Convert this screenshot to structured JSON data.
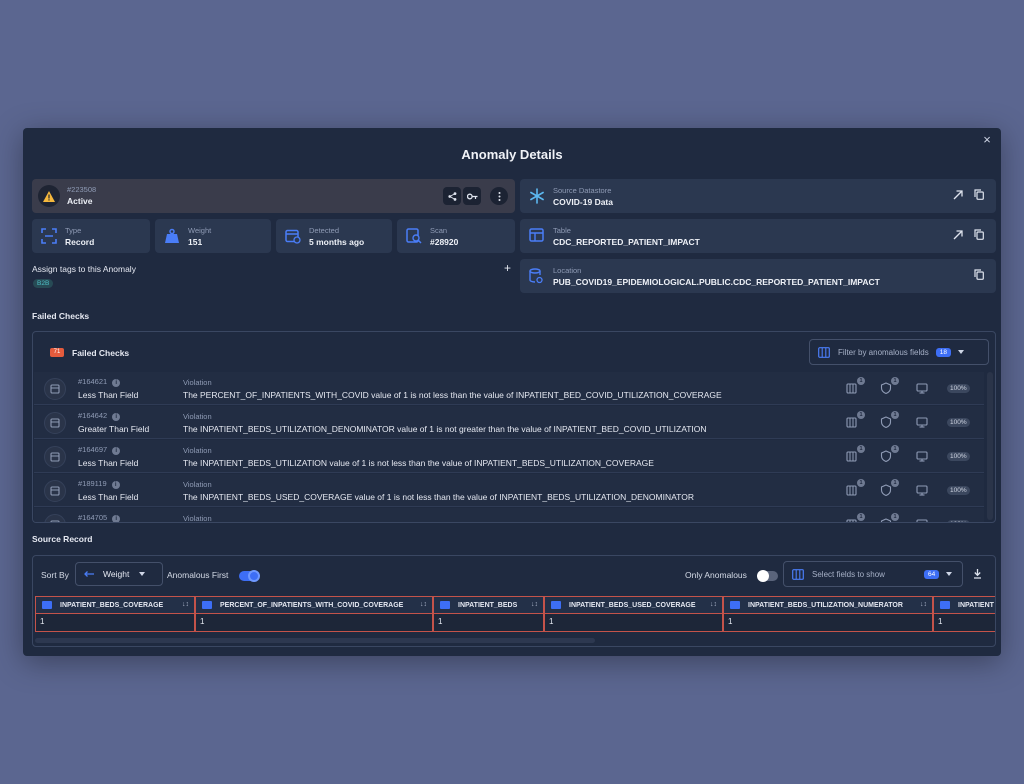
{
  "modal": {
    "title": "Anomaly Details",
    "close": "×"
  },
  "status": {
    "id": "#223508",
    "label": "Active"
  },
  "meta": {
    "type": {
      "label": "Type",
      "value": "Record"
    },
    "weight": {
      "label": "Weight",
      "value": "151"
    },
    "detected": {
      "label": "Detected",
      "value": "5 months ago"
    },
    "scan": {
      "label": "Scan",
      "value": "#28920"
    }
  },
  "tags": {
    "label": "Assign tags to this Anomaly",
    "add": "+",
    "items": [
      "B2B"
    ]
  },
  "source": {
    "datastore": {
      "label": "Source Datastore",
      "value": "COVID-19 Data"
    },
    "table": {
      "label": "Table",
      "value": "CDC_REPORTED_PATIENT_IMPACT"
    },
    "location": {
      "label": "Location",
      "value": "PUB_COVID19_EPIDEMIOLOGICAL.PUBLIC.CDC_REPORTED_PATIENT_IMPACT"
    }
  },
  "failed_checks": {
    "section_label": "Failed Checks",
    "header": "Failed Checks",
    "count": "71",
    "filter": {
      "placeholder": "Filter by anomalous fields",
      "count": "18"
    },
    "violation_label": "Violation",
    "percent": "100%",
    "action_count": "1",
    "rows": [
      {
        "id": "#164621",
        "name": "Less Than Field",
        "violation": "The PERCENT_OF_INPATIENTS_WITH_COVID value of 1 is not less than the value of INPATIENT_BED_COVID_UTILIZATION_COVERAGE"
      },
      {
        "id": "#164642",
        "name": "Greater Than Field",
        "violation": "The INPATIENT_BEDS_UTILIZATION_DENOMINATOR value of 1 is not greater than the value of INPATIENT_BED_COVID_UTILIZATION"
      },
      {
        "id": "#164697",
        "name": "Less Than Field",
        "violation": "The INPATIENT_BEDS_UTILIZATION value of 1 is not less than the value of INPATIENT_BEDS_UTILIZATION_COVERAGE"
      },
      {
        "id": "#189119",
        "name": "Less Than Field",
        "violation": "The INPATIENT_BEDS_USED_COVERAGE value of 1 is not less than the value of INPATIENT_BEDS_UTILIZATION_DENOMINATOR"
      },
      {
        "id": "#164705",
        "name": "",
        "violation": ""
      }
    ]
  },
  "source_record": {
    "section_label": "Source Record",
    "sort_by_label": "Sort By",
    "sort_value": "Weight",
    "anomalous_first_label": "Anomalous First",
    "only_anomalous_label": "Only Anomalous",
    "fields_placeholder": "Select fields to show",
    "fields_count": "64",
    "columns": [
      {
        "name": "INPATIENT_BEDS_COVERAGE",
        "value": "1"
      },
      {
        "name": "PERCENT_OF_INPATIENTS_WITH_COVID_COVERAGE",
        "value": "1"
      },
      {
        "name": "INPATIENT_BEDS",
        "value": "1"
      },
      {
        "name": "INPATIENT_BEDS_USED_COVERAGE",
        "value": "1"
      },
      {
        "name": "INPATIENT_BEDS_UTILIZATION_NUMERATOR",
        "value": "1"
      },
      {
        "name": "INPATIENT",
        "value": "1"
      }
    ]
  },
  "colors": {
    "accent": "#3d6ef5",
    "danger": "#e45b3d",
    "warning": "#f5b83d",
    "highlight_border": "#c4534a"
  }
}
